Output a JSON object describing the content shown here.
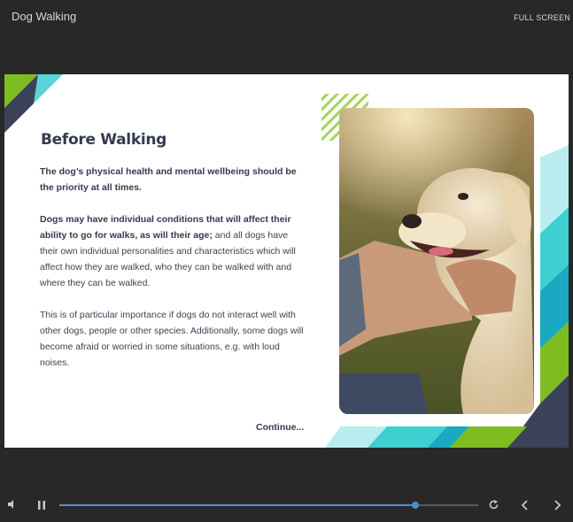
{
  "app": {
    "title": "Dog Walking",
    "fullscreen_label": "FULL SCREEN"
  },
  "slide": {
    "heading": "Before Walking",
    "para1": "The dog’s physical health and mental wellbeing should be the priority at all times.",
    "para2_bold": "Dogs may have individual conditions that will affect their ability to go for walks, as will their age;",
    "para2_rest": " and all dogs have their own individual personalities and characteristics which will affect how they are walked, who they can be walked with and where they can be walked.",
    "para3": "This is of particular importance if dogs do not interact well with other dogs, people or other species. Additionally, some dogs will become afraid or worried in some situations, e.g. with loud noises.",
    "continue_label": "Continue...",
    "image_description": "dog-being-petted-photo"
  },
  "player": {
    "progress": 0.85
  },
  "colors": {
    "background": "#282828",
    "accent_green": "#7dbd22",
    "accent_teal": "#2fc4c4",
    "navy": "#3c4259",
    "progress": "#4a90d0"
  }
}
